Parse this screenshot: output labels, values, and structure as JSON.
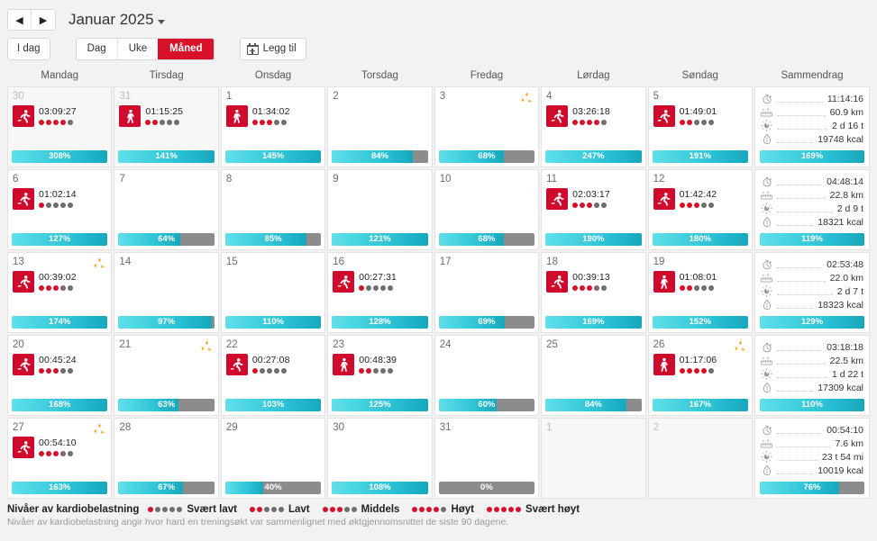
{
  "header": {
    "prev_label": "◀",
    "next_label": "▶",
    "month_title": "Januar 2025"
  },
  "toolbar": {
    "today_label": "I dag",
    "view_day": "Dag",
    "view_week": "Uke",
    "view_month": "Måned",
    "add_label": "Legg til",
    "active_view": "Måned",
    "accent_color": "#d8112a"
  },
  "weekdays": [
    "Mandag",
    "Tirsdag",
    "Onsdag",
    "Torsdag",
    "Fredag",
    "Lørdag",
    "Søndag",
    "Sammendrag"
  ],
  "weeks": [
    {
      "days": [
        {
          "num": "30",
          "outside": true,
          "recycle": false,
          "activity": {
            "type": "run",
            "time": "03:09:27",
            "load": 4
          },
          "bar": {
            "pct": "308%",
            "fill": 100
          }
        },
        {
          "num": "31",
          "outside": true,
          "recycle": false,
          "activity": {
            "type": "walk",
            "time": "01:15:25",
            "load": 2
          },
          "bar": {
            "pct": "141%",
            "fill": 100
          }
        },
        {
          "num": "1",
          "outside": false,
          "recycle": false,
          "activity": {
            "type": "walk",
            "time": "01:34:02",
            "load": 3
          },
          "bar": {
            "pct": "145%",
            "fill": 100
          }
        },
        {
          "num": "2",
          "outside": false,
          "recycle": false,
          "activity": null,
          "bar": {
            "pct": "84%",
            "fill": 84
          }
        },
        {
          "num": "3",
          "outside": false,
          "recycle": true,
          "activity": null,
          "bar": {
            "pct": "68%",
            "fill": 68
          }
        },
        {
          "num": "4",
          "outside": false,
          "recycle": false,
          "activity": {
            "type": "run",
            "time": "03:26:18",
            "load": 4
          },
          "bar": {
            "pct": "247%",
            "fill": 100
          }
        },
        {
          "num": "5",
          "outside": false,
          "recycle": false,
          "activity": {
            "type": "run",
            "time": "01:49:01",
            "load": 2
          },
          "bar": {
            "pct": "191%",
            "fill": 100
          }
        }
      ],
      "summary": {
        "duration": "11:14:16",
        "distance": "60.9 km",
        "recovery": "2 d 16 t",
        "calories": "19748 kcal",
        "bar": {
          "pct": "169%",
          "fill": 100
        }
      }
    },
    {
      "days": [
        {
          "num": "6",
          "outside": false,
          "recycle": false,
          "activity": {
            "type": "run",
            "time": "01:02:14",
            "load": 1
          },
          "bar": {
            "pct": "127%",
            "fill": 100
          }
        },
        {
          "num": "7",
          "outside": false,
          "recycle": false,
          "activity": null,
          "bar": {
            "pct": "64%",
            "fill": 64
          }
        },
        {
          "num": "8",
          "outside": false,
          "recycle": false,
          "activity": null,
          "bar": {
            "pct": "85%",
            "fill": 85
          }
        },
        {
          "num": "9",
          "outside": false,
          "recycle": false,
          "activity": null,
          "bar": {
            "pct": "121%",
            "fill": 100
          }
        },
        {
          "num": "10",
          "outside": false,
          "recycle": false,
          "activity": null,
          "bar": {
            "pct": "68%",
            "fill": 68
          }
        },
        {
          "num": "11",
          "outside": false,
          "recycle": false,
          "activity": {
            "type": "run",
            "time": "02:03:17",
            "load": 3
          },
          "bar": {
            "pct": "190%",
            "fill": 100
          }
        },
        {
          "num": "12",
          "outside": false,
          "recycle": false,
          "activity": {
            "type": "run",
            "time": "01:42:42",
            "load": 3
          },
          "bar": {
            "pct": "180%",
            "fill": 100
          }
        }
      ],
      "summary": {
        "duration": "04:48:14",
        "distance": "22.8 km",
        "recovery": "2 d 9 t",
        "calories": "18321 kcal",
        "bar": {
          "pct": "119%",
          "fill": 100
        }
      }
    },
    {
      "days": [
        {
          "num": "13",
          "outside": false,
          "recycle": true,
          "activity": {
            "type": "run",
            "time": "00:39:02",
            "load": 3
          },
          "bar": {
            "pct": "174%",
            "fill": 100
          }
        },
        {
          "num": "14",
          "outside": false,
          "recycle": false,
          "activity": null,
          "bar": {
            "pct": "97%",
            "fill": 97
          }
        },
        {
          "num": "15",
          "outside": false,
          "recycle": false,
          "activity": null,
          "bar": {
            "pct": "110%",
            "fill": 100
          }
        },
        {
          "num": "16",
          "outside": false,
          "recycle": false,
          "activity": {
            "type": "run",
            "time": "00:27:31",
            "load": 1
          },
          "bar": {
            "pct": "128%",
            "fill": 100
          }
        },
        {
          "num": "17",
          "outside": false,
          "recycle": false,
          "activity": null,
          "bar": {
            "pct": "69%",
            "fill": 69
          }
        },
        {
          "num": "18",
          "outside": false,
          "recycle": false,
          "activity": {
            "type": "run",
            "time": "00:39:13",
            "load": 3
          },
          "bar": {
            "pct": "169%",
            "fill": 100
          }
        },
        {
          "num": "19",
          "outside": false,
          "recycle": false,
          "activity": {
            "type": "walk",
            "time": "01:08:01",
            "load": 2
          },
          "bar": {
            "pct": "152%",
            "fill": 100
          }
        }
      ],
      "summary": {
        "duration": "02:53:48",
        "distance": "22.0 km",
        "recovery": "2 d 7 t",
        "calories": "18323 kcal",
        "bar": {
          "pct": "129%",
          "fill": 100
        }
      }
    },
    {
      "days": [
        {
          "num": "20",
          "outside": false,
          "recycle": false,
          "activity": {
            "type": "run",
            "time": "00:45:24",
            "load": 3
          },
          "bar": {
            "pct": "168%",
            "fill": 100
          }
        },
        {
          "num": "21",
          "outside": false,
          "recycle": true,
          "activity": null,
          "bar": {
            "pct": "63%",
            "fill": 63
          }
        },
        {
          "num": "22",
          "outside": false,
          "recycle": false,
          "activity": {
            "type": "run",
            "time": "00:27:08",
            "load": 1
          },
          "bar": {
            "pct": "103%",
            "fill": 100
          }
        },
        {
          "num": "23",
          "outside": false,
          "recycle": false,
          "activity": {
            "type": "walk",
            "time": "00:48:39",
            "load": 2
          },
          "bar": {
            "pct": "125%",
            "fill": 100
          }
        },
        {
          "num": "24",
          "outside": false,
          "recycle": false,
          "activity": null,
          "bar": {
            "pct": "60%",
            "fill": 60
          }
        },
        {
          "num": "25",
          "outside": false,
          "recycle": false,
          "activity": null,
          "bar": {
            "pct": "84%",
            "fill": 84
          }
        },
        {
          "num": "26",
          "outside": false,
          "recycle": true,
          "activity": {
            "type": "walk",
            "time": "01:17:06",
            "load": 4
          },
          "bar": {
            "pct": "167%",
            "fill": 100
          }
        }
      ],
      "summary": {
        "duration": "03:18:18",
        "distance": "22.5 km",
        "recovery": "1 d 22 t",
        "calories": "17309 kcal",
        "bar": {
          "pct": "110%",
          "fill": 100
        }
      }
    },
    {
      "days": [
        {
          "num": "27",
          "outside": false,
          "recycle": true,
          "activity": {
            "type": "run",
            "time": "00:54:10",
            "load": 3
          },
          "bar": {
            "pct": "163%",
            "fill": 100
          }
        },
        {
          "num": "28",
          "outside": false,
          "recycle": false,
          "activity": null,
          "bar": {
            "pct": "67%",
            "fill": 67
          }
        },
        {
          "num": "29",
          "outside": false,
          "recycle": false,
          "activity": null,
          "bar": {
            "pct": "40%",
            "fill": 40
          }
        },
        {
          "num": "30",
          "outside": false,
          "recycle": false,
          "activity": null,
          "bar": {
            "pct": "108%",
            "fill": 100
          }
        },
        {
          "num": "31",
          "outside": false,
          "recycle": false,
          "activity": null,
          "bar": {
            "pct": "0%",
            "fill": 0
          }
        },
        {
          "num": "1",
          "outside": true,
          "recycle": false,
          "activity": null,
          "bar": null
        },
        {
          "num": "2",
          "outside": true,
          "recycle": false,
          "activity": null,
          "bar": null
        }
      ],
      "summary": {
        "duration": "00:54:10",
        "distance": "7.6 km",
        "recovery": "23 t 54 mi",
        "calories": "10019 kcal",
        "bar": {
          "pct": "76%",
          "fill": 76
        }
      }
    }
  ],
  "legend": {
    "title": "Nivåer av kardiobelastning",
    "levels": [
      {
        "label": "Svært lavt",
        "filled": 1
      },
      {
        "label": "Lavt",
        "filled": 2
      },
      {
        "label": "Middels",
        "filled": 3
      },
      {
        "label": "Høyt",
        "filled": 4
      },
      {
        "label": "Svært høyt",
        "filled": 5
      }
    ],
    "note": "Nivåer av kardiobelastning angir hvor hard en treningsøkt var sammenlignet med øktgjennomsnittet de siste 90 dagene."
  }
}
